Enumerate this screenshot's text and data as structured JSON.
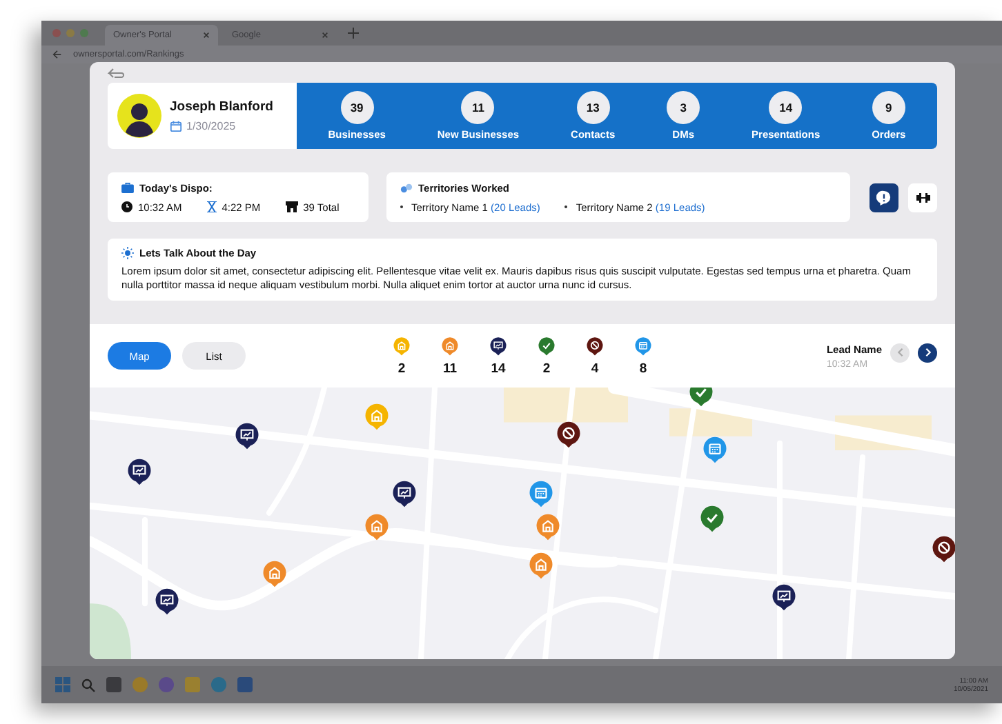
{
  "browser": {
    "tabs": [
      {
        "title": "Owner's Portal",
        "selected": true
      },
      {
        "title": "Google",
        "selected": false
      }
    ],
    "url": "ownersportal.com/Rankings"
  },
  "taskbar": {
    "time": "11:00 AM",
    "date": "10/05/2021"
  },
  "profile": {
    "name": "Joseph Blanford",
    "date": "1/30/2025"
  },
  "stats": [
    {
      "value": "39",
      "label": "Businesses"
    },
    {
      "value": "11",
      "label": "New Businesses"
    },
    {
      "value": "13",
      "label": "Contacts"
    },
    {
      "value": "3",
      "label": "DMs"
    },
    {
      "value": "14",
      "label": "Presentations"
    },
    {
      "value": "9",
      "label": "Orders"
    }
  ],
  "dispo": {
    "title": "Today's Dispo:",
    "start": "10:32 AM",
    "end": "4:22 PM",
    "total": "39 Total"
  },
  "territories": {
    "title": "Territories Worked",
    "items": [
      {
        "name": "Territory Name 1",
        "leads": "(20 Leads)"
      },
      {
        "name": "Territory Name 2",
        "leads": "(19 Leads)"
      }
    ]
  },
  "talk": {
    "title": "Lets Talk About the Day",
    "body": "Lorem ipsum dolor sit amet, consectetur adipiscing elit. Pellentesque vitae velit ex. Mauris dapibus risus quis suscipit vulputate. Egestas sed tempus urna et pharetra. Quam nulla porttitor massa id neque aliquam vestibulum morbi. Nulla aliquet enim tortor at auctor urna nunc id cursus."
  },
  "view_toggle": [
    {
      "label": "Map",
      "selected": true
    },
    {
      "label": "List",
      "selected": false
    }
  ],
  "legend": [
    {
      "kind": "building",
      "color": "#f5b400",
      "count": "2"
    },
    {
      "kind": "building",
      "color": "#ef8a2a",
      "count": "11"
    },
    {
      "kind": "presentation",
      "color": "#1b2157",
      "count": "14"
    },
    {
      "kind": "done",
      "color": "#2a7a2e",
      "count": "2"
    },
    {
      "kind": "blocked",
      "color": "#5e1610",
      "count": "4"
    },
    {
      "kind": "appointment",
      "color": "#2196e8",
      "count": "8"
    }
  ],
  "lead": {
    "name": "Lead Name",
    "time": "10:32 AM",
    "prev_disabled": true,
    "next_disabled": false
  },
  "map": {
    "pins": [
      {
        "kind": "building",
        "color": "#f5b400"
      },
      {
        "kind": "presentation",
        "color": "#1b2157"
      },
      {
        "kind": "presentation",
        "color": "#1b2157"
      },
      {
        "kind": "presentation",
        "color": "#1b2157"
      },
      {
        "kind": "building",
        "color": "#ef8a2a"
      },
      {
        "kind": "building",
        "color": "#ef8a2a"
      },
      {
        "kind": "presentation",
        "color": "#1b2157"
      },
      {
        "kind": "blocked",
        "color": "#5e1610"
      },
      {
        "kind": "appointment",
        "color": "#2196e8"
      },
      {
        "kind": "building",
        "color": "#ef8a2a"
      },
      {
        "kind": "building",
        "color": "#ef8a2a"
      },
      {
        "kind": "done",
        "color": "#2a7a2e"
      },
      {
        "kind": "appointment",
        "color": "#2196e8"
      },
      {
        "kind": "done",
        "color": "#2a7a2e"
      },
      {
        "kind": "presentation",
        "color": "#1b2157"
      },
      {
        "kind": "blocked",
        "color": "#5e1610"
      }
    ]
  }
}
